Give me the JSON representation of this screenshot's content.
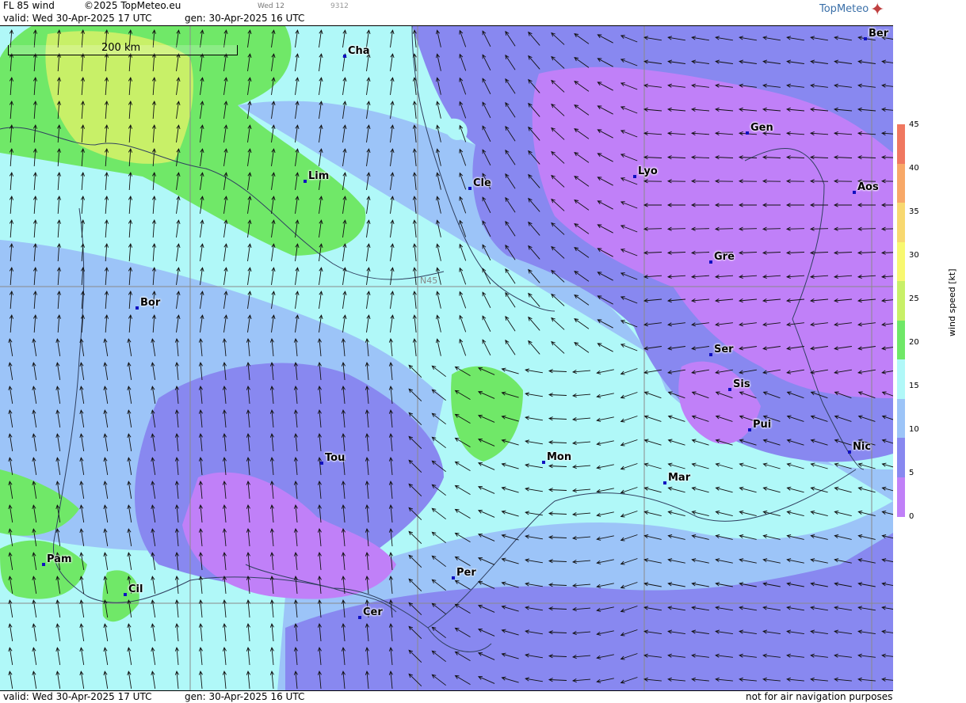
{
  "header": {
    "product": "FL 85 wind",
    "copyright": "©2025 TopMeteo.eu",
    "small_day": "Wed 12",
    "small_code": "9312",
    "valid": "valid:  Wed  30-Apr-2025  17 UTC",
    "gen": "gen: 30-Apr-2025 16 UTC",
    "logo": "TopMeteo"
  },
  "footer": {
    "valid": "valid:  Wed  30-Apr-2025  17 UTC",
    "gen": "gen: 30-Apr-2025 16 UTC",
    "disclaimer": "not for air navigation purposes"
  },
  "scale_bar": "200 km",
  "grid_label": "N45",
  "cities": [
    "Ber",
    "Cha",
    "Gen",
    "Lim",
    "Cle",
    "Lyo",
    "Aos",
    "Gre",
    "Bor",
    "Ser",
    "Sis",
    "Pui",
    "Tou",
    "Mon",
    "Nic",
    "Mar",
    "Pam",
    "Cil",
    "Per",
    "Cer"
  ],
  "legend": {
    "title": "wind speed [kt]",
    "ticks": [
      "45",
      "40",
      "35",
      "30",
      "25",
      "20",
      "15",
      "10",
      "5",
      "0"
    ],
    "colors": [
      "#f07860",
      "#f8a868",
      "#f8d870",
      "#f8f870",
      "#c8f068",
      "#70e868",
      "#b0f8f8",
      "#9cc4f8",
      "#8888f0",
      "#c080f8"
    ]
  },
  "colors": {
    "land_lines": "#304060",
    "border": "#5a5a5a",
    "dot": "#1010c0"
  }
}
